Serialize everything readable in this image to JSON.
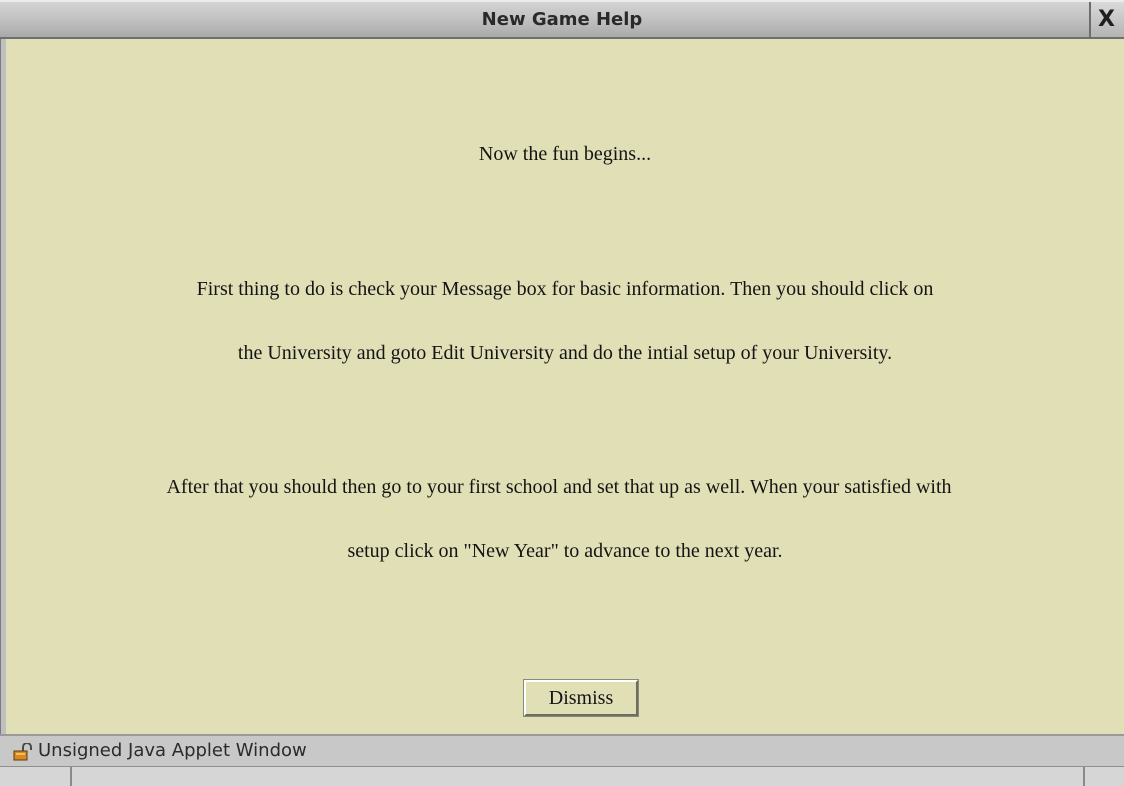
{
  "window": {
    "title": "New Game Help",
    "close_glyph": "X"
  },
  "content": {
    "lines": [
      "Now the fun begins...",
      "First thing to do is check your Message box for basic information. Then you should click on",
      "the University and goto Edit University and do the intial setup of your University.",
      "After that you should then go to your first school and set that up as well. When your satisfied with",
      "setup click on \"New Year\" to advance to the next year."
    ],
    "dismiss_label": "Dismiss"
  },
  "statusbar": {
    "icon": "unlocked-padlock-icon",
    "text": "Unsigned Java Applet Window"
  },
  "colors": {
    "background": "#e1dfb6",
    "titlebar": "#bdbdbd",
    "statusbar": "#c8c8c8",
    "text": "#141414"
  }
}
